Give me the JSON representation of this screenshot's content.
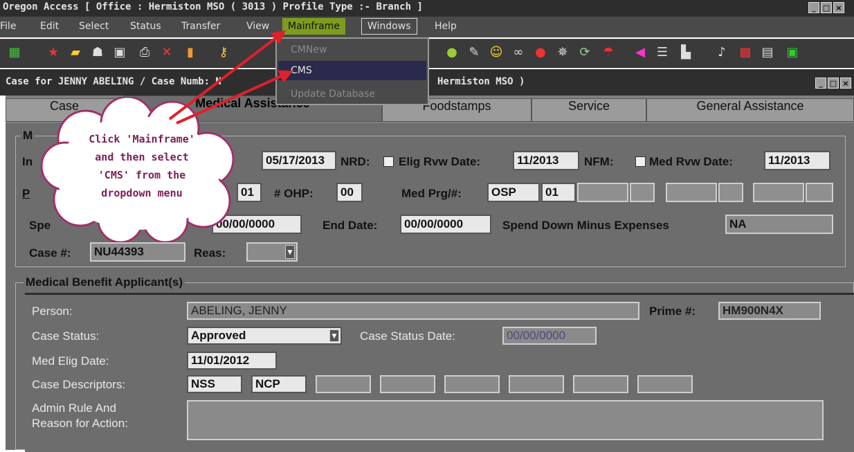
{
  "app": {
    "title": "Oregon Access [ Office : Hermiston MSO ( 3013 ) Profile Type :- Branch ]",
    "window_controls": [
      "_",
      "□",
      "×"
    ]
  },
  "menubar": {
    "items": [
      "File",
      "Edit",
      "Select",
      "Status",
      "Transfer",
      "View",
      "Mainframe",
      "Windows",
      "Help"
    ]
  },
  "dropdown": {
    "items": [
      "CMNew",
      "CMS",
      "Update Database"
    ]
  },
  "case_window": {
    "title": "Case for JENNY ABELING / Case Numb: N",
    "title_suffix": "Hermiston MSO )"
  },
  "tabs": [
    "Case",
    "Medical Assistance",
    "Foodstamps",
    "Service",
    "General Assistance"
  ],
  "medical": {
    "group_title": "M",
    "init_label": "In",
    "init_value": "05/17/2013",
    "nrd_label": "NRD:",
    "elig_rvw_label": "Elig Rvw Date:",
    "elig_rvw_value": "11/2013",
    "nfm_label": "NFM:",
    "med_rvw_label": "Med Rvw Date:",
    "med_rvw_value": "11/2013",
    "p_label": "P",
    "p_value": "01",
    "ohp_label": "# OHP:",
    "ohp_value": "00",
    "med_prg_label": "Med Prg/#:",
    "med_prg_value": "OSP",
    "med_prg_num": "01",
    "spend_label": "Spe",
    "start_date_value": "00/00/0000",
    "end_date_label": "End Date:",
    "end_date_value": "00/00/0000",
    "spend_minus_label": "Spend Down Minus Expenses",
    "spend_minus_value": "NA",
    "case_no_label": "Case #:",
    "case_no_value": "NU44393",
    "reas_label": "Reas:"
  },
  "applicant": {
    "group_title": "Medical Benefit Applicant(s)",
    "person_label": "Person:",
    "person_value": "ABELING, JENNY",
    "prime_label": "Prime #:",
    "prime_value": "HM900N4X",
    "case_status_label": "Case Status:",
    "case_status_value": "Approved",
    "case_status_date_label": "Case Status Date:",
    "case_status_date_value": "00/00/0000",
    "med_elig_label": "Med Elig Date:",
    "med_elig_value": "11/01/2012",
    "descriptors_label": "Case Descriptors:",
    "descriptors": [
      "NSS",
      "NCP",
      "",
      "",
      "",
      "",
      "",
      ""
    ],
    "admin_label_1": "Admin Rule And",
    "admin_label_2": "Reason for Action:"
  },
  "annotation": {
    "line1": "Click 'Mainframe'",
    "line2": "and then select",
    "line3": "'CMS' from the",
    "line4": "dropdown menu",
    "color": "#7a1f55"
  }
}
